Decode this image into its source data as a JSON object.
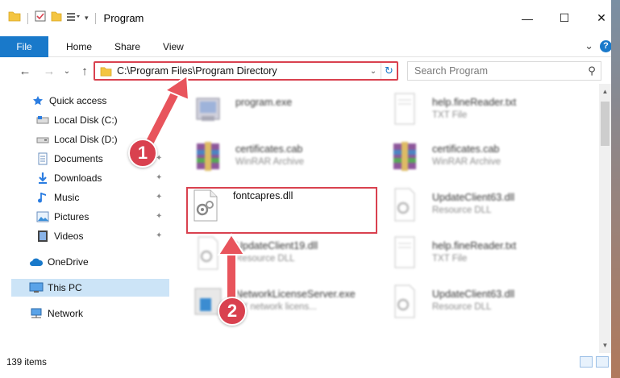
{
  "window": {
    "title": "Program",
    "minimize_glyph": "—",
    "maximize_glyph": "☐",
    "close_glyph": "✕"
  },
  "ribbon": {
    "tabs": [
      "File",
      "Home",
      "Share",
      "View"
    ],
    "help_glyph": "?",
    "expand_glyph": "⌄"
  },
  "address": {
    "path": "C:\\Program Files\\Program Directory",
    "search_placeholder": "Search Program"
  },
  "nav": {
    "back_glyph": "←",
    "forward_glyph": "→",
    "recent_glyph": "⌄",
    "up_glyph": "↑"
  },
  "sidebar": {
    "items": [
      {
        "label": "Quick access",
        "icon": "star-icon",
        "pinned": false
      },
      {
        "label": "Local Disk (C:)",
        "icon": "drive-icon",
        "pinned": false
      },
      {
        "label": "Local Disk (D:)",
        "icon": "drive-icon",
        "pinned": false
      },
      {
        "label": "Documents",
        "icon": "documents-icon",
        "pinned": true
      },
      {
        "label": "Downloads",
        "icon": "download-icon",
        "pinned": true
      },
      {
        "label": "Music",
        "icon": "music-icon",
        "pinned": true
      },
      {
        "label": "Pictures",
        "icon": "pictures-icon",
        "pinned": true
      },
      {
        "label": "Videos",
        "icon": "videos-icon",
        "pinned": true
      },
      {
        "label": "OneDrive",
        "icon": "cloud-icon",
        "pinned": false
      },
      {
        "label": "This PC",
        "icon": "monitor-icon",
        "pinned": false
      },
      {
        "label": "Network",
        "icon": "network-icon",
        "pinned": false
      }
    ],
    "pin_glyph": "📌"
  },
  "files": [
    {
      "name": "program.exe",
      "type": "",
      "icon": "exe-icon"
    },
    {
      "name": "help.fineReader.txt",
      "type": "TXT File",
      "icon": "txt-icon"
    },
    {
      "name": "certificates.cab",
      "type": "WinRAR Archive",
      "icon": "winrar-icon"
    },
    {
      "name": "certificates.cab",
      "type": "WinRAR Archive",
      "icon": "winrar-icon"
    },
    {
      "name": "fontcapres.dll",
      "type": "",
      "icon": "dll-icon"
    },
    {
      "name": "UpdateClient63.dll",
      "type": "Resource DLL",
      "icon": "dll-icon"
    },
    {
      "name": "UpdateClient19.dll",
      "type": "Resource DLL",
      "icon": "dll-icon"
    },
    {
      "name": "help.fineReader.txt",
      "type": "TXT File",
      "icon": "txt-icon"
    },
    {
      "name": "NetworkLicenseServer.exe",
      "type": "BY network licens...",
      "icon": "exe-blue-icon"
    },
    {
      "name": "UpdateClient63.dll",
      "type": "Resource DLL",
      "icon": "dll-icon"
    }
  ],
  "annotations": {
    "badge1": "1",
    "badge2": "2"
  },
  "status": {
    "item_count": "139 items"
  },
  "colors": {
    "accent": "#1979ca",
    "highlight": "#d9414f",
    "selected": "#cce4f7"
  }
}
